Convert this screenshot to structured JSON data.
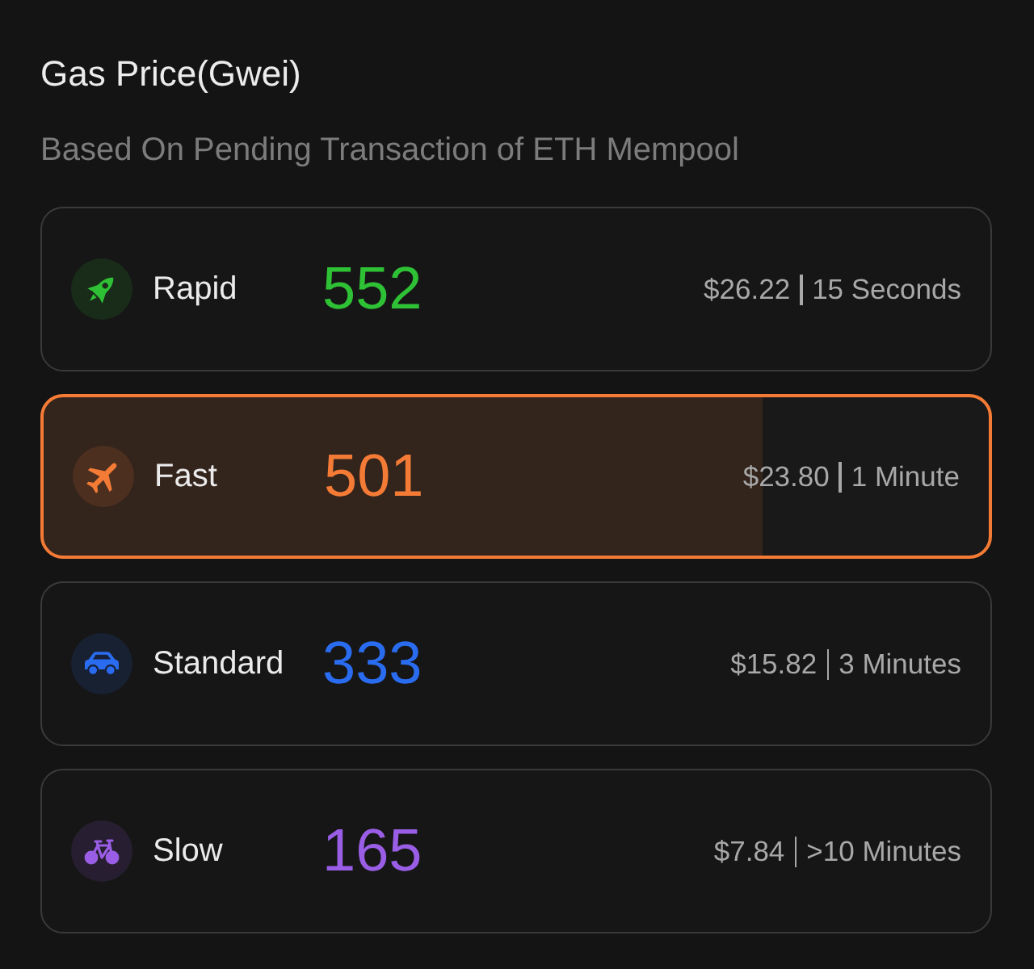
{
  "header": {
    "title": "Gas Price(Gwei)",
    "subtitle": "Based On Pending Transaction of ETH Mempool"
  },
  "options": [
    {
      "name": "Rapid",
      "price": "552",
      "cost": "$26.22",
      "time": "15 Seconds",
      "color": "#2fc135",
      "selected": false
    },
    {
      "name": "Fast",
      "price": "501",
      "cost": "$23.80",
      "time": "1 Minute",
      "color": "#f47b36",
      "selected": true,
      "level": 0.76
    },
    {
      "name": "Standard",
      "price": "333",
      "cost": "$15.82",
      "time": "3 Minutes",
      "color": "#2a6cf0",
      "selected": false
    },
    {
      "name": "Slow",
      "price": "165",
      "cost": "$7.84",
      "time": ">10 Minutes",
      "color": "#9a5ee6",
      "selected": false
    }
  ]
}
